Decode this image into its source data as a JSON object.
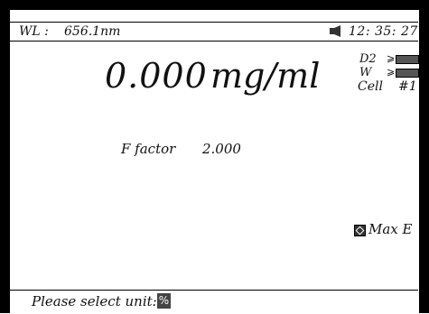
{
  "status_bar": {
    "wl_label": "WL :",
    "wl_value": "656.1nm",
    "time": "12: 35: 27",
    "speaker_icon": "speaker-icon"
  },
  "reading": {
    "value": "0.000",
    "unit": "mg/ml"
  },
  "lamps": {
    "d2_label": "D2",
    "w_label": "W",
    "tick_symbol": "⩾",
    "cell_label": "Cell",
    "cell_number": "#1"
  },
  "factor": {
    "label": "F factor",
    "value": "2.000"
  },
  "mode": {
    "label": "Max  E",
    "icon": "diamond-key-icon"
  },
  "prompt": {
    "text": "Please select unit:",
    "key_label": "%"
  }
}
